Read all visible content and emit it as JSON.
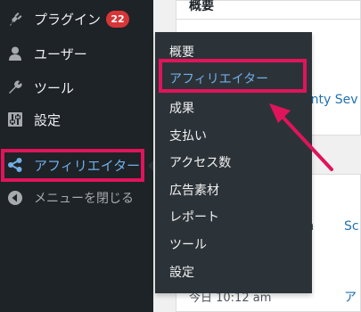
{
  "sidebar": {
    "items": [
      {
        "label": "プラグイン",
        "icon": "plugin-icon",
        "badge": "22"
      },
      {
        "label": "ユーザー",
        "icon": "user-icon"
      },
      {
        "label": "ツール",
        "icon": "wrench-icon"
      },
      {
        "label": "設定",
        "icon": "settings-icon"
      },
      {
        "label": "アフィリエイター",
        "icon": "share-icon",
        "active": true
      },
      {
        "label": "メニューを閉じる",
        "icon": "collapse-icon"
      }
    ]
  },
  "submenu": {
    "items": [
      "概要",
      "アフィリエイター",
      "成果",
      "支払い",
      "アクセス数",
      "広告素材",
      "レポート",
      "ツール",
      "設定"
    ]
  },
  "main": {
    "overview_heading": "概要",
    "theme_link": "enty Sev",
    "text_om": "om",
    "link_sc": "Sc",
    "timestamp": "今日 10:12 am",
    "link_a": "ア"
  },
  "colors": {
    "sidebar_bg": "#1d2327",
    "flyout_bg": "#2c3338",
    "active_text": "#72aee6",
    "highlight": "#e0145a",
    "badge": "#d63638",
    "link": "#2271b1"
  }
}
